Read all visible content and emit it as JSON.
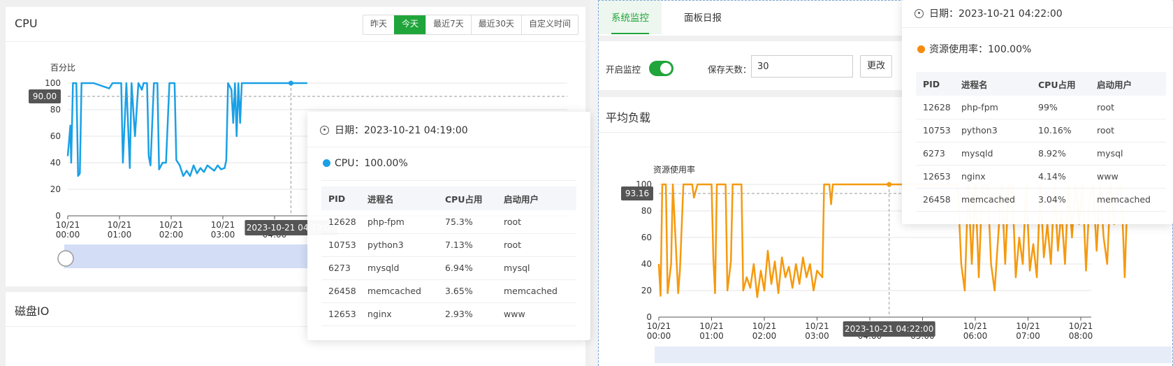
{
  "cpu_panel": {
    "title": "CPU",
    "ranges": [
      "昨天",
      "今天",
      "最近7天",
      "最近30天",
      "自定义时间"
    ],
    "active_range": "今天",
    "y_axis_name": "百分比",
    "marker_label": "90.00",
    "x_pointer_label": "2023-10-21 04:19:00",
    "line_color": "#1aa0e6"
  },
  "disk_panel": {
    "title": "磁盘IO"
  },
  "cpu_tooltip": {
    "date_label": "日期：2023-10-21 04:19:00",
    "series_label": "CPU：100.00%",
    "dot_color": "#1aa0e6",
    "columns": [
      "PID",
      "进程名",
      "CPU占用",
      "启动用户"
    ],
    "rows": [
      [
        "12628",
        "php-fpm",
        "75.3%",
        "root"
      ],
      [
        "10753",
        "python3",
        "7.13%",
        "root"
      ],
      [
        "6273",
        "mysqld",
        "6.94%",
        "mysql"
      ],
      [
        "26458",
        "memcached",
        "3.65%",
        "memcached"
      ],
      [
        "12653",
        "nginx",
        "2.93%",
        "www"
      ]
    ]
  },
  "right_panel": {
    "tabs": [
      "系统监控",
      "面板日报"
    ],
    "active_tab": "系统监控",
    "monitor_label": "开启监控",
    "monitor_enabled": true,
    "days_label": "保存天数：",
    "days_value": "30",
    "change_button": "更改",
    "load_title": "平均负载",
    "y_axis_name": "资源使用率",
    "marker_label": "93.16",
    "x_pointer_label": "2023-10-21 04:22:00",
    "line_color": "#f59a0e"
  },
  "load_tooltip": {
    "date_label": "日期：2023-10-21 04:22:00",
    "series_label": "资源使用率：100.00%",
    "dot_color": "#f58a0e",
    "columns": [
      "PID",
      "进程名",
      "CPU占用",
      "启动用户"
    ],
    "rows": [
      [
        "12628",
        "php-fpm",
        "99%",
        "root"
      ],
      [
        "10753",
        "python3",
        "10.16%",
        "root"
      ],
      [
        "6273",
        "mysqld",
        "8.92%",
        "mysql"
      ],
      [
        "12653",
        "nginx",
        "4.14%",
        "www"
      ],
      [
        "26458",
        "memcached",
        "3.04%",
        "memcached"
      ]
    ]
  },
  "chart_data": [
    {
      "type": "line",
      "name": "cpu",
      "ylabel": "百分比",
      "ylim": [
        0,
        100
      ],
      "y_ticks": [
        0,
        20,
        40,
        60,
        80,
        100
      ],
      "x_tick_labels": [
        "10/21\n00:00",
        "10/21\n01:00",
        "10/21\n02:00",
        "10/21\n03:00",
        "10/21\n04:00"
      ],
      "series": [
        {
          "points": [
            [
              "00:00",
              45
            ],
            [
              "00:03",
              68
            ],
            [
              "00:04",
              40
            ],
            [
              "00:06",
              100
            ],
            [
              "00:10",
              100
            ],
            [
              "00:12",
              30
            ],
            [
              "00:14",
              32
            ],
            [
              "00:16",
              100
            ],
            [
              "00:30",
              100
            ],
            [
              "00:48",
              96
            ],
            [
              "00:52",
              100
            ],
            [
              "01:02",
              100
            ],
            [
              "01:04",
              40
            ],
            [
              "01:08",
              100
            ],
            [
              "01:12",
              36
            ],
            [
              "01:14",
              100
            ],
            [
              "01:18",
              60
            ],
            [
              "01:22",
              100
            ],
            [
              "01:26",
              95
            ],
            [
              "01:28",
              100
            ],
            [
              "01:32",
              100
            ],
            [
              "01:34",
              45
            ],
            [
              "01:36",
              38
            ],
            [
              "01:40",
              100
            ],
            [
              "01:44",
              100
            ],
            [
              "01:46",
              35
            ],
            [
              "01:50",
              40
            ],
            [
              "01:54",
              40
            ],
            [
              "01:58",
              100
            ],
            [
              "02:04",
              100
            ],
            [
              "02:06",
              42
            ],
            [
              "02:10",
              38
            ],
            [
              "02:14",
              30
            ],
            [
              "02:18",
              34
            ],
            [
              "02:22",
              30
            ],
            [
              "02:26",
              38
            ],
            [
              "02:30",
              32
            ],
            [
              "02:34",
              36
            ],
            [
              "02:38",
              33
            ],
            [
              "02:42",
              38
            ],
            [
              "02:46",
              36
            ],
            [
              "02:50",
              34
            ],
            [
              "02:54",
              38
            ],
            [
              "02:58",
              35
            ],
            [
              "03:02",
              36
            ],
            [
              "03:04",
              42
            ],
            [
              "03:06",
              100
            ],
            [
              "03:10",
              95
            ],
            [
              "03:12",
              70
            ],
            [
              "03:14",
              100
            ],
            [
              "03:16",
              60
            ],
            [
              "03:18",
              100
            ],
            [
              "03:20",
              70
            ],
            [
              "03:22",
              100
            ],
            [
              "03:26",
              100
            ],
            [
              "04:00",
              100
            ],
            [
              "04:19",
              100
            ],
            [
              "04:30",
              100
            ],
            [
              "04:38",
              100
            ]
          ]
        }
      ]
    },
    {
      "type": "line",
      "name": "load",
      "ylabel": "资源使用率",
      "ylim": [
        0,
        100
      ],
      "y_ticks": [
        0,
        20,
        40,
        60,
        80,
        100
      ],
      "x_tick_labels": [
        "10/21\n00:00",
        "10/21\n01:00",
        "10/21\n02:00",
        "10/21\n03:00",
        "10/21\n04:00",
        "10/21\n05:00",
        "10/21\n06:00",
        "10/21\n07:00",
        "10/21\n08:00"
      ],
      "series": [
        {
          "points": [
            [
              "00:00",
              40
            ],
            [
              "00:02",
              16
            ],
            [
              "00:04",
              100
            ],
            [
              "00:08",
              100
            ],
            [
              "00:10",
              18
            ],
            [
              "00:14",
              40
            ],
            [
              "00:16",
              100
            ],
            [
              "00:22",
              18
            ],
            [
              "00:24",
              35
            ],
            [
              "00:28",
              100
            ],
            [
              "00:38",
              100
            ],
            [
              "00:40",
              90
            ],
            [
              "00:44",
              100
            ],
            [
              "01:00",
              100
            ],
            [
              "01:02",
              45
            ],
            [
              "01:04",
              18
            ],
            [
              "01:06",
              100
            ],
            [
              "01:12",
              100
            ],
            [
              "01:16",
              100
            ],
            [
              "01:18",
              20
            ],
            [
              "01:22",
              42
            ],
            [
              "01:24",
              100
            ],
            [
              "01:34",
              100
            ],
            [
              "01:36",
              20
            ],
            [
              "01:40",
              30
            ],
            [
              "01:44",
              22
            ],
            [
              "01:48",
              40
            ],
            [
              "01:52",
              15
            ],
            [
              "01:56",
              35
            ],
            [
              "02:00",
              20
            ],
            [
              "02:04",
              50
            ],
            [
              "02:08",
              25
            ],
            [
              "02:12",
              42
            ],
            [
              "02:16",
              18
            ],
            [
              "02:20",
              45
            ],
            [
              "02:24",
              30
            ],
            [
              "02:28",
              38
            ],
            [
              "02:32",
              22
            ],
            [
              "02:36",
              40
            ],
            [
              "02:40",
              25
            ],
            [
              "02:44",
              45
            ],
            [
              "02:48",
              30
            ],
            [
              "02:52",
              40
            ],
            [
              "02:56",
              20
            ],
            [
              "03:00",
              35
            ],
            [
              "03:06",
              30
            ],
            [
              "03:08",
              100
            ],
            [
              "03:14",
              100
            ],
            [
              "03:16",
              85
            ],
            [
              "03:18",
              100
            ],
            [
              "03:40",
              100
            ],
            [
              "04:00",
              100
            ],
            [
              "04:22",
              100
            ],
            [
              "05:15",
              100
            ],
            [
              "05:40",
              100
            ],
            [
              "05:44",
              40
            ],
            [
              "05:48",
              20
            ],
            [
              "05:52",
              100
            ],
            [
              "05:56",
              40
            ],
            [
              "06:00",
              100
            ],
            [
              "06:04",
              30
            ],
            [
              "06:08",
              100
            ],
            [
              "06:14",
              100
            ],
            [
              "06:18",
              40
            ],
            [
              "06:22",
              20
            ],
            [
              "06:26",
              60
            ],
            [
              "06:30",
              100
            ],
            [
              "06:34",
              40
            ],
            [
              "06:38",
              100
            ],
            [
              "06:42",
              100
            ],
            [
              "06:46",
              30
            ],
            [
              "06:50",
              60
            ],
            [
              "06:54",
              40
            ],
            [
              "06:58",
              100
            ],
            [
              "07:02",
              35
            ],
            [
              "07:06",
              55
            ],
            [
              "07:10",
              30
            ],
            [
              "07:14",
              100
            ],
            [
              "07:18",
              45
            ],
            [
              "07:22",
              70
            ],
            [
              "07:26",
              40
            ],
            [
              "07:30",
              100
            ],
            [
              "07:34",
              50
            ],
            [
              "07:38",
              80
            ],
            [
              "07:42",
              40
            ],
            [
              "07:46",
              100
            ],
            [
              "07:50",
              60
            ],
            [
              "07:54",
              100
            ],
            [
              "07:58",
              70
            ],
            [
              "08:02",
              100
            ],
            [
              "08:06",
              35
            ],
            [
              "08:10",
              90
            ],
            [
              "08:14",
              100
            ],
            [
              "08:18",
              50
            ],
            [
              "08:22",
              100
            ],
            [
              "08:26",
              60
            ],
            [
              "08:30",
              40
            ],
            [
              "08:34",
              100
            ],
            [
              "08:38",
              70
            ],
            [
              "08:42",
              95
            ],
            [
              "08:46",
              100
            ],
            [
              "08:50",
              30
            ],
            [
              "08:52",
              70
            ]
          ]
        }
      ]
    }
  ]
}
